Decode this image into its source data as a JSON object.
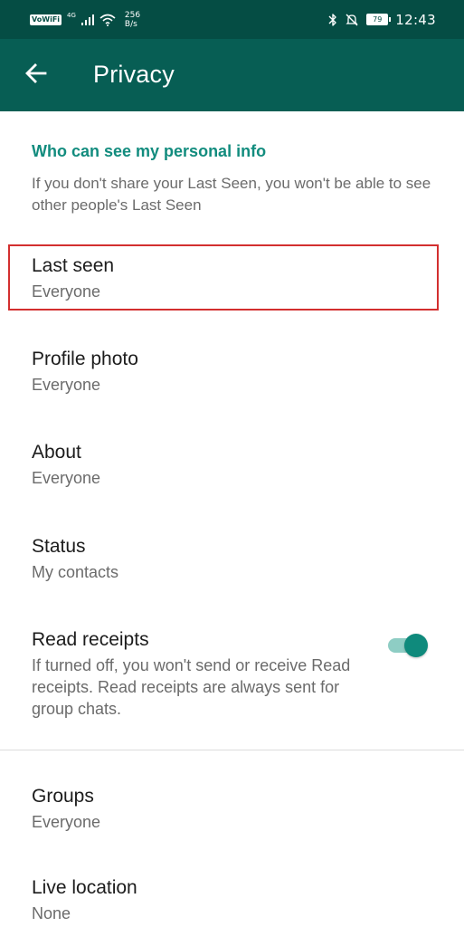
{
  "status_bar": {
    "badge": "VoWiFi",
    "network": "4G",
    "speed_value": "256",
    "speed_unit": "B/s",
    "battery": "79",
    "time": "12:43"
  },
  "app_bar": {
    "title": "Privacy",
    "back_icon": "arrow-back-icon"
  },
  "section": {
    "header": "Who can see my personal info",
    "description": "If you don't share your Last Seen, you won't be able to see other people's Last Seen"
  },
  "items": [
    {
      "title": "Last seen",
      "value": "Everyone"
    },
    {
      "title": "Profile photo",
      "value": "Everyone"
    },
    {
      "title": "About",
      "value": "Everyone"
    },
    {
      "title": "Status",
      "value": "My contacts"
    },
    {
      "title": "Read receipts",
      "value": "If turned off, you won't send or receive Read receipts. Read receipts are always sent for group chats.",
      "toggle_on": true
    },
    {
      "title": "Groups",
      "value": "Everyone"
    },
    {
      "title": "Live location",
      "value": "None"
    }
  ],
  "colors": {
    "status_bar": "#054d44",
    "app_bar": "#075e54",
    "accent": "#128c7e",
    "highlight": "#d32f2f"
  }
}
